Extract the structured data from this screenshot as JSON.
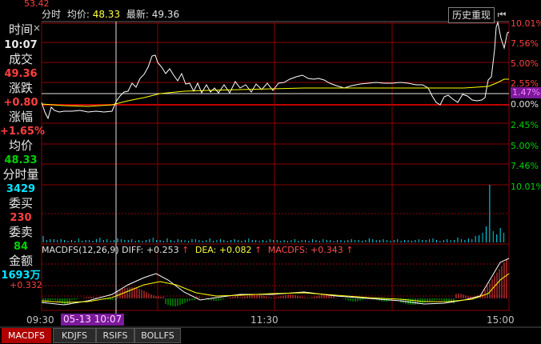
{
  "topbar": {
    "mode": "分时",
    "avg_label": "均价:",
    "avg_value": "48.33",
    "last_label": "最新:",
    "last_value": "49.36",
    "history_button": "历史重现",
    "top_price_partial": "53.42"
  },
  "info_panel": {
    "time_label": "时间",
    "time_value": "10:07",
    "volume_label": "成交",
    "volume_value": "49.36",
    "change_label": "涨跌",
    "change_value": "+0.80",
    "pct_label": "涨幅",
    "pct_value": "+1.65%",
    "avg_label": "均价",
    "avg_value": "48.33",
    "minute_vol_label": "分时量",
    "minute_vol_value": "3429",
    "bid_label": "委买",
    "bid_value": "230",
    "ask_label": "委卖",
    "ask_value": "84",
    "amount_label": "金额",
    "amount_value": "1693万"
  },
  "right_scale": {
    "up": [
      "10.01%",
      "7.56%",
      "5.00%",
      "2.55%"
    ],
    "cursor": "1.47%",
    "zero": "0.00%",
    "down": [
      "2.45%",
      "5.00%",
      "7.46%"
    ],
    "volume_top": "10.01%"
  },
  "macd": {
    "title": "MACDFS(12,26,9)",
    "diff_label": "DIFF:",
    "diff_value": "+0.253",
    "dea_label": "DEA:",
    "dea_value": "+0.082",
    "macdfs_label": "MACDFS:",
    "macdfs_value": "+0.343",
    "axis_value": "+0.332",
    "arrow": "↑"
  },
  "time_axis": {
    "start": "09:30",
    "cursor": "05-13 10:07",
    "mid": "11:30",
    "end": "15:00"
  },
  "tabs": [
    "MACDFS",
    "KDJFS",
    "RSIFS",
    "BOLLFS"
  ],
  "colors": {
    "up": "#ff4040",
    "down": "#00d000",
    "price_line": "#ffffff",
    "avg_line": "#ffff00",
    "grid": "#8b0000",
    "cyan": "#00e5ff",
    "magenta": "#ff40ff"
  }
}
